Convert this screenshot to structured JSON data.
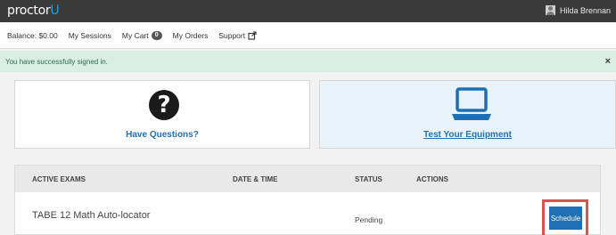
{
  "header": {
    "logo_text": "proctor",
    "logo_accent": "U",
    "user_name": "Hilda Brennan"
  },
  "nav": {
    "balance": "Balance: $0.00",
    "sessions": "My Sessions",
    "cart": "My Cart",
    "cart_count": "0",
    "orders": "My Orders",
    "support": "Support"
  },
  "alert": {
    "message": "You have successfully signed in.",
    "close": "×"
  },
  "cards": {
    "questions_label": "Have Questions?",
    "equipment_label": "Test Your Equipment",
    "questions_icon": "question-circle-icon",
    "equipment_icon": "laptop-icon"
  },
  "table": {
    "headers": [
      "ACTIVE EXAMS",
      "DATE & TIME",
      "STATUS",
      "ACTIONS"
    ],
    "rows": [
      {
        "exam": "TABE 12 Math Auto-locator",
        "datetime": "",
        "status": "Pending",
        "action": "Schedule"
      }
    ]
  },
  "colors": {
    "topbar": "#3a3a3a",
    "accent_blue": "#2470b3",
    "alert_bg": "#d9eee4",
    "highlight_red": "#d9534f"
  }
}
